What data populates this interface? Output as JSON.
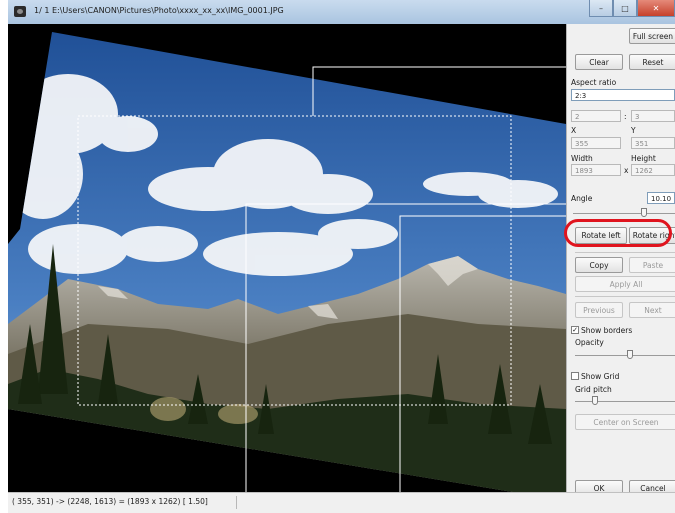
{
  "window": {
    "title": "1/ 1 E:\\Users\\CANON\\Pictures\\Photo\\xxxx_xx_xx\\IMG_0001.JPG",
    "minimize": "–",
    "maximize": "□",
    "close": "✕"
  },
  "toolbar": {
    "full_screen": "Full screen",
    "clear": "Clear",
    "reset": "Reset"
  },
  "aspect": {
    "label": "Aspect ratio",
    "value": "2:3",
    "w": "2",
    "h": "3",
    "sep": ":"
  },
  "position": {
    "x_label": "X",
    "y_label": "Y",
    "x": "355",
    "y": "351",
    "width_label": "Width",
    "height_label": "Height",
    "width": "1893",
    "height": "1262",
    "times": "x"
  },
  "angle": {
    "label": "Angle",
    "value": "10.10",
    "slider_fraction": 0.7
  },
  "rotate": {
    "left": "Rotate left",
    "right": "Rotate right"
  },
  "edit": {
    "copy": "Copy",
    "paste": "Paste",
    "apply_all": "Apply All"
  },
  "nav": {
    "previous": "Previous",
    "next": "Next"
  },
  "borders": {
    "show_label": "Show borders",
    "checked": true,
    "opacity_label": "Opacity",
    "opacity_fraction": 0.55
  },
  "grid": {
    "show_label": "Show Grid",
    "checked": false,
    "pitch_label": "Grid pitch",
    "pitch_fraction": 0.2,
    "center": "Center on Screen"
  },
  "dialog": {
    "ok": "OK",
    "cancel": "Cancel"
  },
  "status": {
    "text": "( 355,  351) -> (2248, 1613) = (1893 x 1262) [ 1.50]"
  },
  "colors": {
    "highlight": "#e0141e",
    "sky": "#3c6fb4",
    "mountain": "#7d7766",
    "forest": "#1f2d18"
  }
}
